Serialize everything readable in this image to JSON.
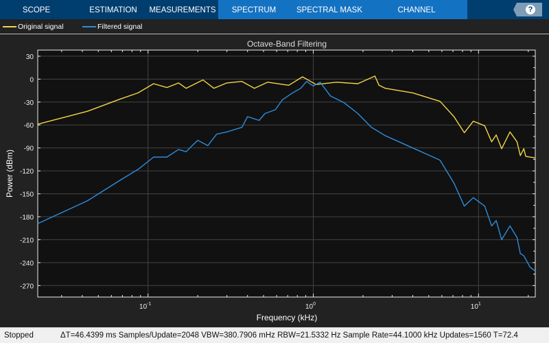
{
  "toolbar": {
    "tabs": [
      "SCOPE",
      "ESTIMATION",
      "MEASUREMENTS",
      "SPECTRUM",
      "SPECTRAL MASK",
      "CHANNEL MEASUREMENTS"
    ],
    "help": "?"
  },
  "legend": {
    "items": [
      {
        "label": "Original signal",
        "color": "#f5d646"
      },
      {
        "label": "Filtered signal",
        "color": "#2b8ee0"
      }
    ]
  },
  "status": {
    "state": "Stopped",
    "info": "ΔT=46.4399 ms  Samples/Update=2048  VBW=380.7906 mHz  RBW=21.5332 Hz  Sample Rate=44.1000 kHz  Updates=1560  T=72.4"
  },
  "chart_data": {
    "type": "line",
    "title": "Octave-Band Filtering",
    "xlabel": "Frequency (kHz)",
    "ylabel": "Power (dBm)",
    "xscale": "log",
    "xlim": [
      0.0215,
      22.05
    ],
    "ylim": [
      -285,
      38
    ],
    "yticks": [
      30,
      0,
      -30,
      -60,
      -90,
      -120,
      -150,
      -180,
      -210,
      -240,
      -270
    ],
    "xticks": [
      {
        "value": 0.1,
        "base": "10",
        "exp": "-1"
      },
      {
        "value": 1,
        "base": "10",
        "exp": "0"
      },
      {
        "value": 10,
        "base": "10",
        "exp": "1"
      }
    ],
    "grid": true,
    "series": [
      {
        "name": "Original signal",
        "color": "#f5d646",
        "points": [
          [
            0.0215,
            -59
          ],
          [
            0.043,
            -42
          ],
          [
            0.068,
            -26
          ],
          [
            0.087,
            -18
          ],
          [
            0.108,
            -6
          ],
          [
            0.13,
            -11
          ],
          [
            0.153,
            -5
          ],
          [
            0.17,
            -12
          ],
          [
            0.215,
            -1
          ],
          [
            0.25,
            -12
          ],
          [
            0.3,
            -5
          ],
          [
            0.37,
            -3
          ],
          [
            0.44,
            -12
          ],
          [
            0.53,
            -4
          ],
          [
            0.71,
            -8
          ],
          [
            0.86,
            3
          ],
          [
            1.04,
            -7
          ],
          [
            1.38,
            -4
          ],
          [
            1.86,
            -6
          ],
          [
            2.36,
            4
          ],
          [
            2.5,
            -8
          ],
          [
            2.73,
            -12
          ],
          [
            4.0,
            -18
          ],
          [
            5.85,
            -29
          ],
          [
            7.1,
            -49
          ],
          [
            8.2,
            -70
          ],
          [
            9.3,
            -55
          ],
          [
            10.9,
            -61
          ],
          [
            12,
            -82
          ],
          [
            12.8,
            -73
          ],
          [
            13.8,
            -91
          ],
          [
            15.5,
            -69
          ],
          [
            17.1,
            -82
          ],
          [
            17.9,
            -100
          ],
          [
            18.8,
            -91
          ],
          [
            19.3,
            -101
          ],
          [
            22.05,
            -103
          ]
        ]
      },
      {
        "name": "Filtered signal",
        "color": "#2b8ee0",
        "points": [
          [
            0.0215,
            -189
          ],
          [
            0.043,
            -159
          ],
          [
            0.068,
            -132
          ],
          [
            0.087,
            -118
          ],
          [
            0.108,
            -102
          ],
          [
            0.13,
            -102
          ],
          [
            0.153,
            -92
          ],
          [
            0.17,
            -95
          ],
          [
            0.185,
            -87
          ],
          [
            0.2,
            -80
          ],
          [
            0.23,
            -87
          ],
          [
            0.26,
            -72
          ],
          [
            0.3,
            -69
          ],
          [
            0.37,
            -63
          ],
          [
            0.4,
            -49
          ],
          [
            0.47,
            -54
          ],
          [
            0.51,
            -45
          ],
          [
            0.59,
            -40
          ],
          [
            0.65,
            -27
          ],
          [
            0.75,
            -18
          ],
          [
            0.84,
            -12
          ],
          [
            0.91,
            -3
          ],
          [
            1.0,
            -9
          ],
          [
            1.1,
            -4
          ],
          [
            1.27,
            -22
          ],
          [
            1.54,
            -31
          ],
          [
            1.86,
            -45
          ],
          [
            2.25,
            -63
          ],
          [
            2.73,
            -74
          ],
          [
            4.0,
            -90
          ],
          [
            5.85,
            -106
          ],
          [
            7.1,
            -136
          ],
          [
            8.2,
            -166
          ],
          [
            9.3,
            -155
          ],
          [
            10.9,
            -166
          ],
          [
            12,
            -192
          ],
          [
            12.8,
            -185
          ],
          [
            13.8,
            -210
          ],
          [
            15.5,
            -192
          ],
          [
            17.1,
            -207
          ],
          [
            17.9,
            -228
          ],
          [
            18.8,
            -231
          ],
          [
            20.5,
            -246
          ],
          [
            22.05,
            -251
          ]
        ]
      }
    ]
  }
}
